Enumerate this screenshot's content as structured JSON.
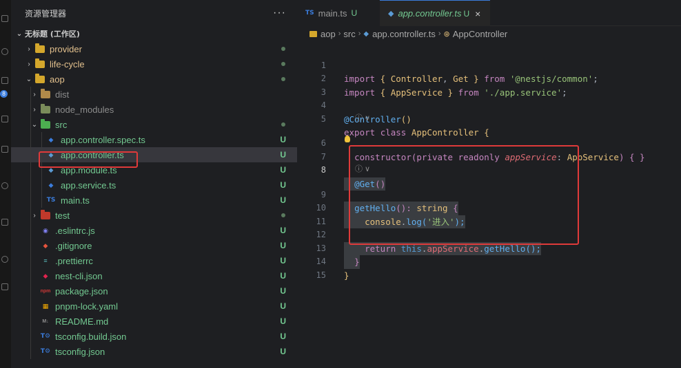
{
  "sidebar": {
    "title": "资源管理器",
    "more": "···",
    "workspace": "无标题 (工作区)",
    "items": [
      {
        "label": "provider",
        "status": "dot"
      },
      {
        "label": "life-cycle",
        "status": "dot"
      },
      {
        "label": "aop",
        "status": "dot"
      },
      {
        "label": "dist",
        "status": ""
      },
      {
        "label": "node_modules",
        "status": ""
      },
      {
        "label": "src",
        "status": "dot"
      },
      {
        "label": "app.controller.spec.ts",
        "status": "U"
      },
      {
        "label": "app.controller.ts",
        "status": "U"
      },
      {
        "label": "app.module.ts",
        "status": "U"
      },
      {
        "label": "app.service.ts",
        "status": "U"
      },
      {
        "label": "main.ts",
        "status": "U"
      },
      {
        "label": "test",
        "status": "dot"
      },
      {
        "label": ".eslintrc.js",
        "status": "U"
      },
      {
        "label": ".gitignore",
        "status": "U"
      },
      {
        "label": ".prettierrc",
        "status": "U"
      },
      {
        "label": "nest-cli.json",
        "status": "U"
      },
      {
        "label": "package.json",
        "status": "U"
      },
      {
        "label": "pnpm-lock.yaml",
        "status": "U"
      },
      {
        "label": "README.md",
        "status": "U"
      },
      {
        "label": "tsconfig.build.json",
        "status": "U"
      },
      {
        "label": "tsconfig.json",
        "status": "U"
      }
    ]
  },
  "activity": {
    "badge": "8"
  },
  "tabs": [
    {
      "icon": "TS",
      "name": "main.ts",
      "status": "U"
    },
    {
      "name": "app.controller.ts",
      "status": "U",
      "close": "×"
    }
  ],
  "breadcrumb": {
    "parts": [
      "aop",
      "src",
      "app.controller.ts",
      "AppController"
    ]
  },
  "editor": {
    "line_numbers": [
      "1",
      "2",
      "3",
      "4",
      "5",
      "6",
      "7",
      "8",
      "9",
      "10",
      "11",
      "12",
      "13",
      "14",
      "15"
    ],
    "lens_text": "ⓘ ∨",
    "code": {
      "l1": [
        "import",
        " { ",
        "Controller",
        ", ",
        "Get",
        " } ",
        "from",
        " ",
        "'@nestjs/common'",
        ";"
      ],
      "l2": [
        "import",
        " { ",
        "AppService",
        " } ",
        "from",
        " ",
        "'./app.service'",
        ";"
      ],
      "l4": [
        "@Controller",
        "()"
      ],
      "l5": [
        "export",
        " ",
        "class",
        " ",
        "AppController",
        " ",
        "{"
      ],
      "l6": [
        "  ",
        "constructor",
        "(",
        "private",
        " ",
        "readonly",
        " ",
        "appService",
        ": ",
        "AppService",
        ") { }"
      ],
      "l8": [
        "  ",
        "@Get",
        "()"
      ],
      "l9": [
        "  ",
        "getHello",
        "(): ",
        "string",
        " {"
      ],
      "l10": [
        "    ",
        "console",
        ".",
        "log",
        "(",
        "'进入'",
        ");"
      ],
      "l12": [
        "    ",
        "return",
        " ",
        "this",
        ".",
        "appService",
        ".",
        "getHello",
        "();"
      ],
      "l13": [
        "  ",
        "}"
      ],
      "l14": [
        "}"
      ]
    }
  },
  "colors": {
    "accent": "#3b7ddd",
    "highlight": "#e03a3a",
    "untracked": "#73c991"
  }
}
